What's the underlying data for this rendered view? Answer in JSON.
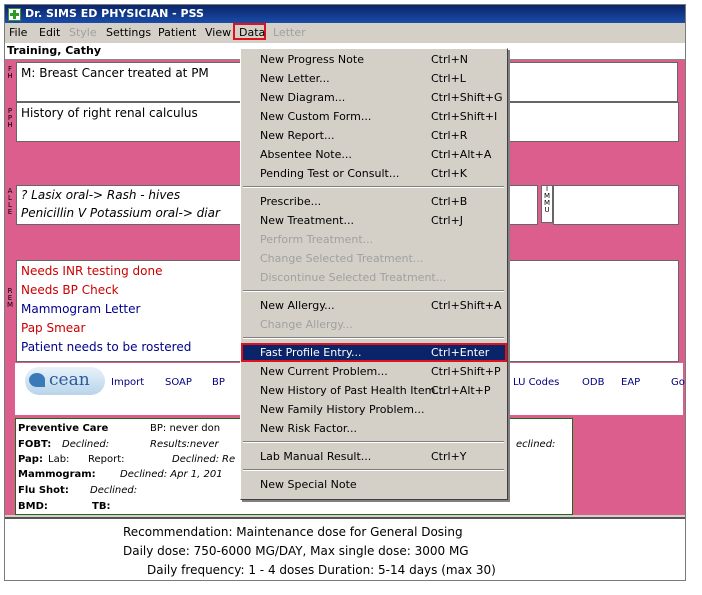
{
  "window": {
    "title": "Dr. SIMS ED PHYSICIAN - PSS"
  },
  "menubar": {
    "items": [
      "File",
      "Edit",
      "Style",
      "Settings",
      "Patient",
      "View",
      "Data",
      "Letter"
    ]
  },
  "patient": {
    "name": "Training, Cathy"
  },
  "side_labels": {
    "fh": "F\nH",
    "pph": "P\nP\nH",
    "alle": "A\nL\nL\nE",
    "immu": "I\nM\nM\nU",
    "rem": "R\nE\nM"
  },
  "fh_text": "M: Breast Cancer treated at PM",
  "pph_text": "History of right renal calculus",
  "allergies": [
    "? Lasix oral-> Rash - hives",
    "Penicillin V Potassium oral-> diar"
  ],
  "reminders": [
    {
      "text": "Needs INR testing done",
      "color": "red"
    },
    {
      "text": "Needs BP Check",
      "color": "red"
    },
    {
      "text": "Mammogram Letter",
      "color": "blue"
    },
    {
      "text": "Pap Smear",
      "color": "red"
    },
    {
      "text": "Patient needs to be rostered",
      "color": "blue"
    }
  ],
  "toolbar": {
    "logo": "cean",
    "links": [
      "Import",
      "SOAP",
      "BP",
      "LU Codes",
      "ODB",
      "EAP",
      "Go"
    ]
  },
  "preventive": {
    "title": "Preventive Care",
    "bp": "BP:  never don",
    "fobt": "FOBT:",
    "fobt_status": "Declined:",
    "fobt_results": "Results:never",
    "fobt_right": "eclined:",
    "pap": "Pap:",
    "pap_lab": "Lab:",
    "pap_report": "Report:",
    "pap_declined": "Declined:",
    "pap_re": "Re",
    "mammogram": "Mammogram:",
    "mammogram_status": "Declined: Apr 1, 201",
    "flu": "Flu Shot:",
    "flu_status": "Declined:",
    "bmd": "BMD:",
    "tb": "TB:"
  },
  "recommendation": {
    "line1": "Recommendation: Maintenance dose for General Dosing",
    "line2": "Daily dose: 750-6000 MG/DAY, Max single dose: 3000 MG",
    "line3": "Daily frequency: 1 - 4 doses     Duration: 5-14 days (max 30)"
  },
  "data_menu": {
    "items": [
      {
        "label": "New Progress Note",
        "shortcut": "Ctrl+N",
        "enabled": true
      },
      {
        "label": "New Letter...",
        "shortcut": "Ctrl+L",
        "enabled": true
      },
      {
        "label": "New Diagram...",
        "shortcut": "Ctrl+Shift+G",
        "enabled": true
      },
      {
        "label": "New Custom Form...",
        "shortcut": "Ctrl+Shift+I",
        "enabled": true
      },
      {
        "label": "New Report...",
        "shortcut": "Ctrl+R",
        "enabled": true
      },
      {
        "label": "Absentee Note...",
        "shortcut": "Ctrl+Alt+A",
        "enabled": true
      },
      {
        "label": "Pending Test or Consult...",
        "shortcut": "Ctrl+K",
        "enabled": true
      },
      {
        "label": "Prescribe...",
        "shortcut": "Ctrl+B",
        "enabled": true
      },
      {
        "label": "New Treatment...",
        "shortcut": "Ctrl+J",
        "enabled": true
      },
      {
        "label": "Perform Treatment...",
        "shortcut": "",
        "enabled": false
      },
      {
        "label": "Change Selected Treatment...",
        "shortcut": "",
        "enabled": false
      },
      {
        "label": "Discontinue Selected Treatment...",
        "shortcut": "",
        "enabled": false
      },
      {
        "label": "New Allergy...",
        "shortcut": "Ctrl+Shift+A",
        "enabled": true
      },
      {
        "label": "Change Allergy...",
        "shortcut": "",
        "enabled": false
      },
      {
        "label": "Fast Profile Entry...",
        "shortcut": "Ctrl+Enter",
        "enabled": true
      },
      {
        "label": "New Current Problem...",
        "shortcut": "Ctrl+Shift+P",
        "enabled": true
      },
      {
        "label": "New History of Past Health Item...",
        "shortcut": "Ctrl+Alt+P",
        "enabled": true
      },
      {
        "label": "New Family History Problem...",
        "shortcut": "",
        "enabled": true
      },
      {
        "label": "New Risk Factor...",
        "shortcut": "",
        "enabled": true
      },
      {
        "label": "Lab Manual Result...",
        "shortcut": "Ctrl+Y",
        "enabled": true
      },
      {
        "label": "New Special Note",
        "shortcut": "",
        "enabled": true
      }
    ]
  },
  "colors": {
    "accent_pink": "#dc5e8c",
    "highlight": "#0a246a",
    "callout_red": "#e0101c"
  }
}
